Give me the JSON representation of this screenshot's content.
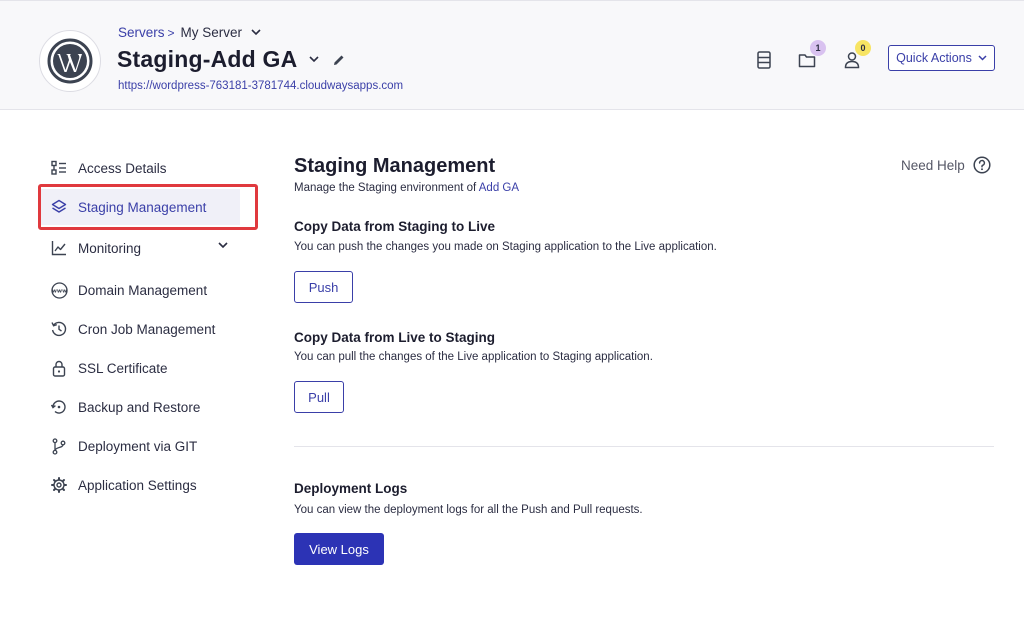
{
  "header": {
    "breadcrumb": {
      "servers_label": "Servers",
      "separator": ">",
      "server_name": "My Server"
    },
    "app_title": "Staging-Add GA",
    "app_url": "https://wordpress-763181-3781744.cloudwaysapps.com",
    "icons": {
      "server": "server-icon",
      "folder": "folder-icon",
      "user": "user-icon"
    },
    "badges": {
      "folder_count": "1",
      "user_count": "0"
    },
    "badge_colors": {
      "folder": "#d9c2f0",
      "user": "#f7e463"
    },
    "quick_actions_label": "Quick Actions"
  },
  "sidebar": {
    "items": [
      {
        "label": "Access Details",
        "icon": "access-details-icon"
      },
      {
        "label": "Staging Management",
        "icon": "layers-icon",
        "active": true
      },
      {
        "label": "Monitoring",
        "icon": "chart-icon",
        "expandable": true
      },
      {
        "label": "Domain Management",
        "icon": "www-icon"
      },
      {
        "label": "Cron Job Management",
        "icon": "clock-history-icon"
      },
      {
        "label": "SSL Certificate",
        "icon": "lock-icon"
      },
      {
        "label": "Backup and Restore",
        "icon": "restore-icon"
      },
      {
        "label": "Deployment via GIT",
        "icon": "git-branch-icon"
      },
      {
        "label": "Application Settings",
        "icon": "gear-icon"
      }
    ]
  },
  "main": {
    "title": "Staging Management",
    "subtitle_prefix": "Manage the Staging environment of",
    "subtitle_app": "Add GA",
    "need_help_label": "Need Help",
    "push_section": {
      "title": "Copy Data from Staging to Live",
      "description": "You can push the changes you made on Staging application to the Live application.",
      "button_label": "Push"
    },
    "pull_section": {
      "title": "Copy Data from Live to Staging",
      "description": "You can pull the changes of the Live application to Staging application.",
      "button_label": "Pull"
    },
    "logs_section": {
      "title": "Deployment Logs",
      "description": "You can view the deployment logs for all the Push and Pull requests.",
      "button_label": "View Logs"
    }
  },
  "colors": {
    "accent": "#3a3fa8",
    "primary_button": "#2c33b5",
    "highlight": "#e0393e"
  }
}
